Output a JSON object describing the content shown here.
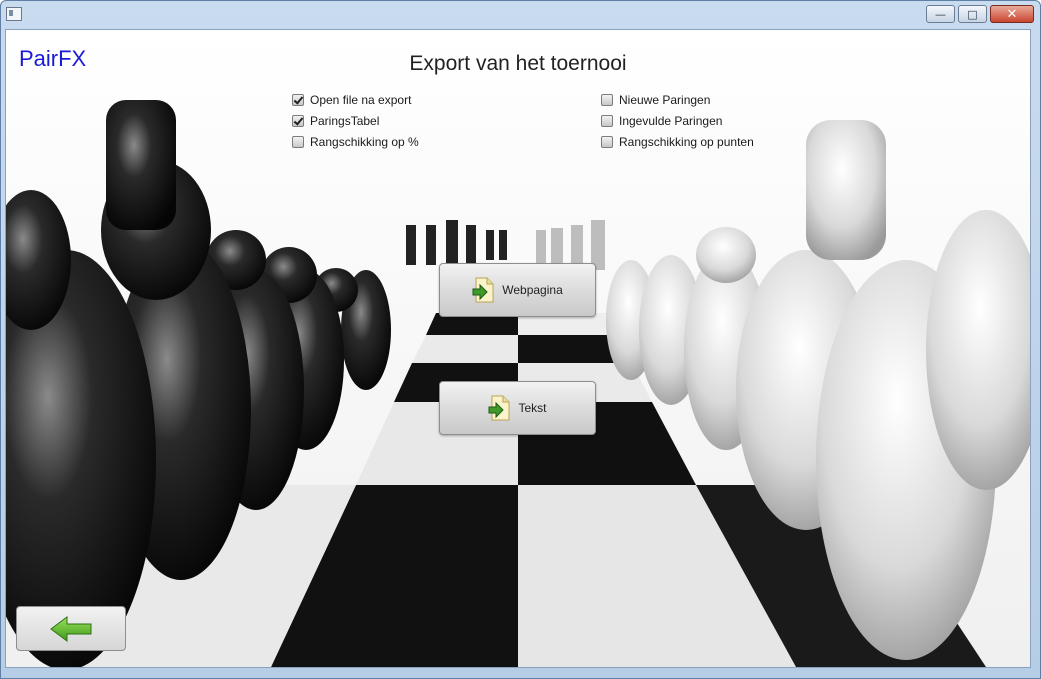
{
  "window": {
    "controls": [
      "minimize-icon",
      "maximize-icon",
      "close-icon"
    ]
  },
  "app": {
    "brand": "PairFX",
    "title": "Export van het toernooi"
  },
  "options_left": [
    {
      "label": "Open file na export",
      "checked": true
    },
    {
      "label": "ParingsTabel",
      "checked": true
    },
    {
      "label": "Rangschikking op %",
      "checked": false
    }
  ],
  "options_right": [
    {
      "label": "Nieuwe Paringen",
      "checked": false
    },
    {
      "label": "Ingevulde Paringen",
      "checked": false
    },
    {
      "label": "Rangschikking op punten",
      "checked": false
    }
  ],
  "actions": {
    "webpage_label": "Webpagina",
    "text_label": "Tekst"
  },
  "colors": {
    "brand": "#1a1ad6",
    "arrow_green": "#4caf1e"
  }
}
